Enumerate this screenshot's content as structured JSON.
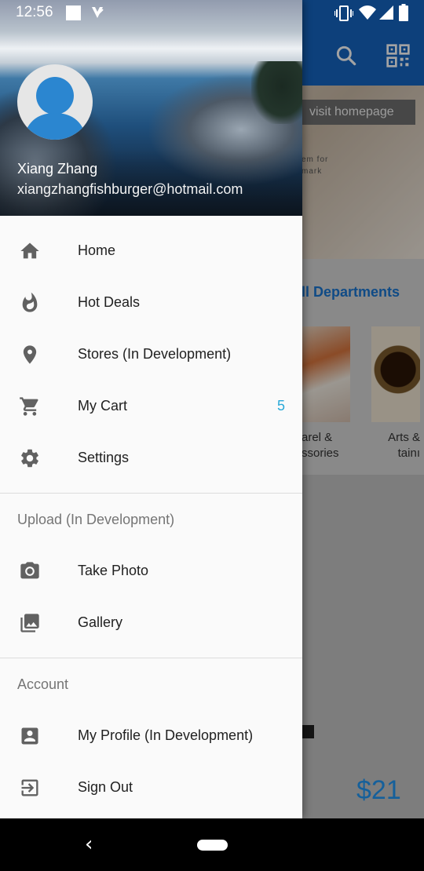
{
  "status_bar": {
    "time": "12:56"
  },
  "background_app": {
    "visit_homepage": "visit homepage",
    "banner_small_1": "em for",
    "banner_small_2": "mark",
    "departments_heading": "ll Departments",
    "category_1": "arel &\nssories",
    "category_2": "Arts &\ntainı",
    "price": "$21"
  },
  "drawer": {
    "user": {
      "name": "Xiang Zhang",
      "email": "xiangzhangfishburger@hotmail.com"
    },
    "main_items": [
      {
        "label": "Home",
        "icon": "home-icon"
      },
      {
        "label": "Hot Deals",
        "icon": "fire-icon"
      },
      {
        "label": "Stores (In Development)",
        "icon": "location-pin-icon"
      },
      {
        "label": "My Cart",
        "icon": "cart-icon",
        "badge": "5"
      },
      {
        "label": "Settings",
        "icon": "gear-icon"
      }
    ],
    "upload_section": {
      "title": "Upload (In Development)",
      "items": [
        {
          "label": "Take Photo",
          "icon": "camera-icon"
        },
        {
          "label": "Gallery",
          "icon": "gallery-icon"
        }
      ]
    },
    "account_section": {
      "title": "Account",
      "items": [
        {
          "label": "My Profile (In Development)",
          "icon": "profile-card-icon"
        },
        {
          "label": "Sign Out",
          "icon": "sign-out-icon"
        }
      ]
    }
  },
  "colors": {
    "accent": "#29a9d8",
    "toolbar": "#1565c0",
    "icon_gray": "#616161"
  }
}
